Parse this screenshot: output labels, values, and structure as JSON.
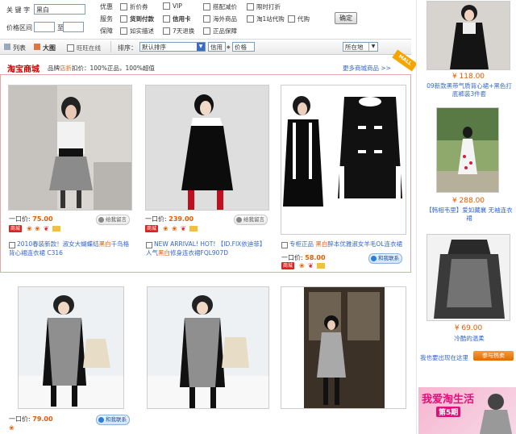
{
  "filters": {
    "keyword_label": "关 键 字",
    "keyword_value": "黑白",
    "price_label": "价格区间",
    "price_to": "至",
    "row_labels": [
      "优惠",
      "服务",
      "保障"
    ],
    "checks": [
      [
        "折价券",
        "VIP",
        "搭配减价",
        "限时打折"
      ],
      [
        "货到付款",
        "信用卡",
        "海外商品",
        "淘1站代购",
        "代购"
      ],
      [
        "如实描述",
        "7天退换",
        "正品保障"
      ]
    ],
    "confirm_label": "确定"
  },
  "toolbar": {
    "list_label": "列表",
    "bigpic_label": "大图",
    "wangwang_label": "旺旺在线",
    "sort_label": "排序：",
    "sort_value": "默认排序",
    "credit_label": "信用",
    "price_label": "价格",
    "location_value": "所在地"
  },
  "mall": {
    "logo": "淘宝商城",
    "tagline_pre": "品牌",
    "tagline_hl": "店",
    "tagline_mid": "折",
    "tagline_post": "扣价：100%正品，100%超值",
    "more": "更多商城商品 >>",
    "ribbon": "MALL"
  },
  "mall_items": [
    {
      "price_label": "一口价:",
      "price": "75.00",
      "contact": "给我留言",
      "desc_a": "2010春装新款！淑女大蝴蝶结",
      "desc_hl": "黑白",
      "desc_b": "千鸟格背心裙连衣裙 C316"
    },
    {
      "price_label": "一口价:",
      "price": "239.00",
      "contact": "给我留言",
      "desc_a": "NEW ARRIVAL! HOT! 【ID.FIX依迪菲】 人气",
      "desc_hl": "黑白",
      "desc_b": "修身连衣裙FQL907D"
    },
    {
      "price_label": "一口价:",
      "price": "58.00",
      "contact": "和我联系",
      "desc_a": "专柜正品 ",
      "desc_hl": "黑白",
      "desc_b": "醉本优雅淑女羊毛OL连衣裙"
    }
  ],
  "grid_items": [
    {
      "price_label": "一口价:",
      "price": "79.00",
      "contact": "和我联系"
    }
  ],
  "sidebar": {
    "items": [
      {
        "price": "¥ 118.00",
        "desc": "09新款黑带气质背心裙+黑色打底裤装3件套"
      },
      {
        "price": "¥ 288.00",
        "desc": "【韩相韦里】爱如藏襄 无袖连衣裙"
      },
      {
        "price": "¥ 69.00",
        "desc": "冷酷的温柔"
      }
    ],
    "promo_label": "我也要出现在这里",
    "promo_button": "参与热卖",
    "banner_text": "我爱淘生活",
    "banner_sub": "第5期"
  }
}
